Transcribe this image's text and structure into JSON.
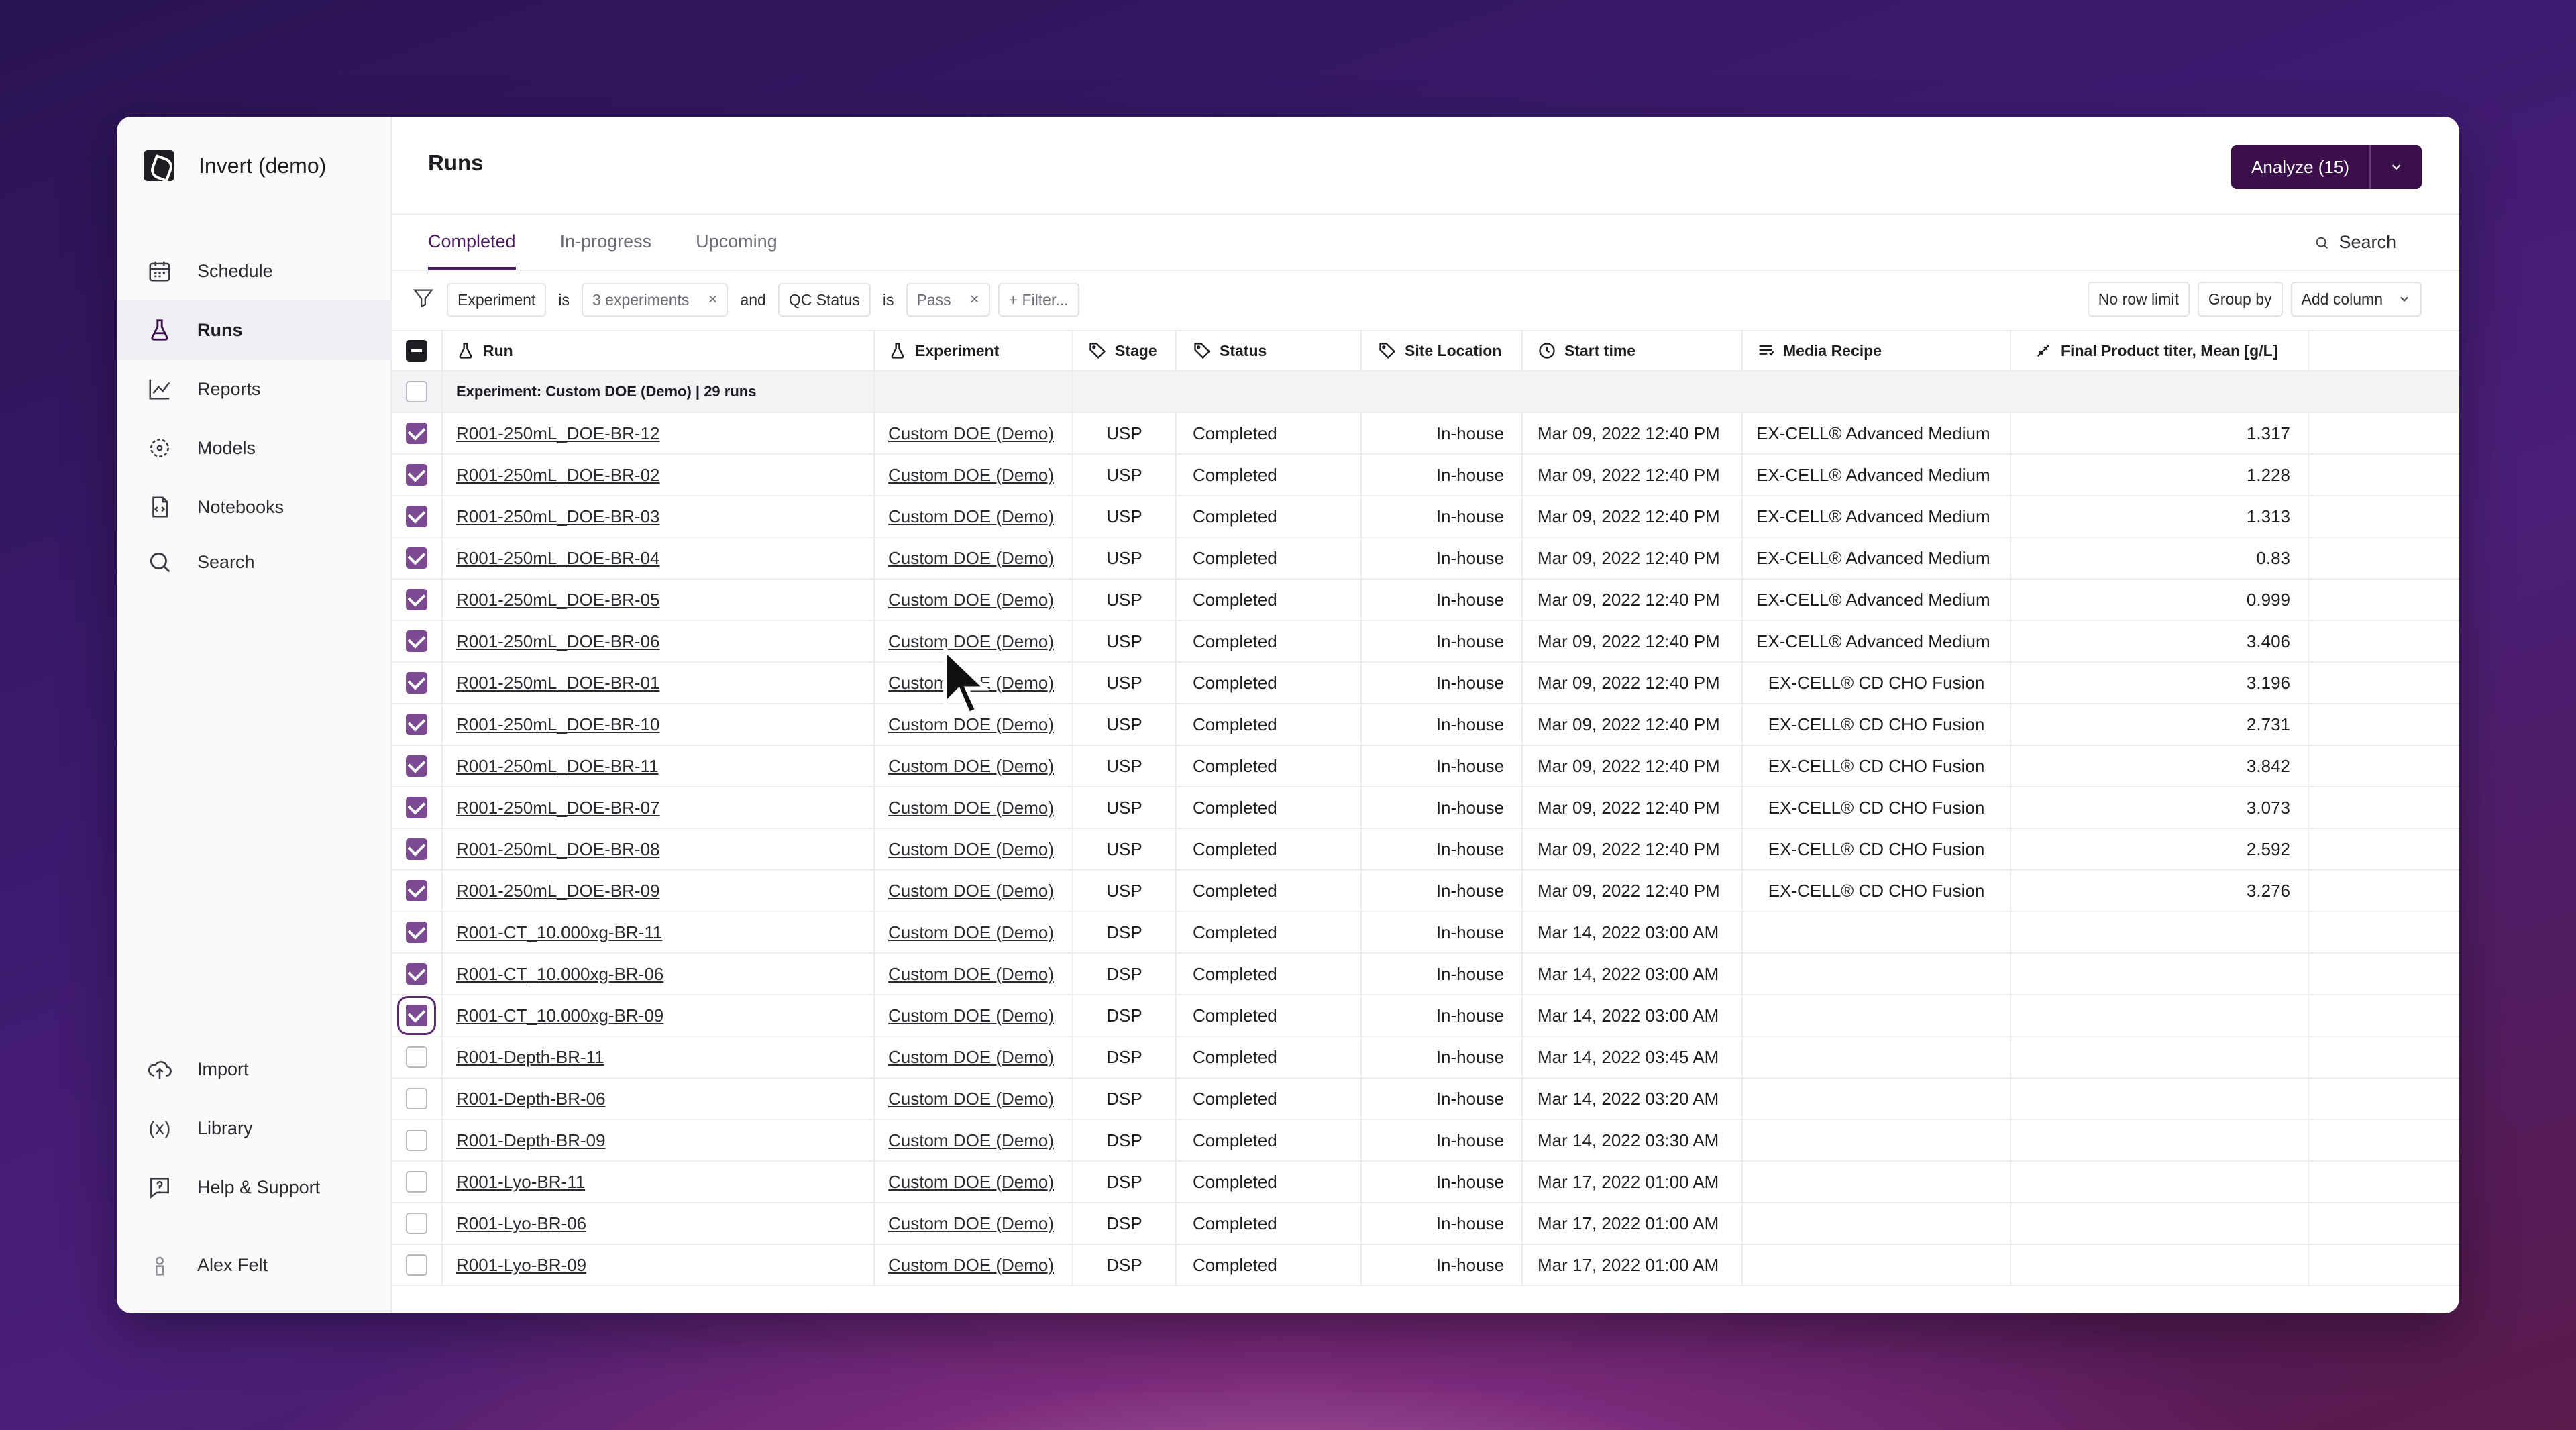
{
  "app": {
    "name": "Invert (demo)"
  },
  "sidebar": {
    "items": [
      {
        "label": "Schedule",
        "icon": "calendar-icon"
      },
      {
        "label": "Runs",
        "icon": "flask-icon",
        "active": true
      },
      {
        "label": "Reports",
        "icon": "chart-line-icon"
      },
      {
        "label": "Models",
        "icon": "models-icon"
      },
      {
        "label": "Notebooks",
        "icon": "notebook-icon"
      },
      {
        "label": "Search",
        "icon": "search-icon"
      }
    ],
    "bottom_items": [
      {
        "label": "Import",
        "icon": "upload-cloud-icon"
      },
      {
        "label": "Library",
        "icon": "function-icon"
      },
      {
        "label": "Help & Support",
        "icon": "help-icon"
      }
    ],
    "user": {
      "name": "Alex Felt",
      "icon": "user-icon"
    }
  },
  "header": {
    "title": "Runs",
    "analyze_label": "Analyze (15)"
  },
  "tabs": [
    "Completed",
    "In-progress",
    "Upcoming"
  ],
  "search_label": "Search",
  "filters": {
    "f1_field": "Experiment",
    "f1_op": "is",
    "f1_value": "3 experiments",
    "joiner": "and",
    "f2_field": "QC Status",
    "f2_op": "is",
    "f2_value": "Pass",
    "add_filter": "+ Filter..."
  },
  "toolbar": {
    "row_limit": "No row limit",
    "group_by": "Group by",
    "add_column": "Add column"
  },
  "table": {
    "headers": {
      "run": "Run",
      "experiment": "Experiment",
      "stage": "Stage",
      "status": "Status",
      "site": "Site Location",
      "start": "Start time",
      "media": "Media Recipe",
      "titer": "Final Product titer, Mean [g/L]"
    },
    "group_label": "Experiment: Custom DOE (Demo) | 29 runs",
    "rows": [
      {
        "checked": true,
        "run": "R001-250mL_DOE-BR-12",
        "experiment": "Custom DOE (Demo)",
        "stage": "USP",
        "status": "Completed",
        "site": "In-house",
        "start": "Mar 09, 2022 12:40 PM",
        "media": "EX-CELL® Advanced Medium",
        "titer": "1.317"
      },
      {
        "checked": true,
        "run": "R001-250mL_DOE-BR-02",
        "experiment": "Custom DOE (Demo)",
        "stage": "USP",
        "status": "Completed",
        "site": "In-house",
        "start": "Mar 09, 2022 12:40 PM",
        "media": "EX-CELL® Advanced Medium",
        "titer": "1.228"
      },
      {
        "checked": true,
        "run": "R001-250mL_DOE-BR-03",
        "experiment": "Custom DOE (Demo)",
        "stage": "USP",
        "status": "Completed",
        "site": "In-house",
        "start": "Mar 09, 2022 12:40 PM",
        "media": "EX-CELL® Advanced Medium",
        "titer": "1.313"
      },
      {
        "checked": true,
        "run": "R001-250mL_DOE-BR-04",
        "experiment": "Custom DOE (Demo)",
        "stage": "USP",
        "status": "Completed",
        "site": "In-house",
        "start": "Mar 09, 2022 12:40 PM",
        "media": "EX-CELL® Advanced Medium",
        "titer": "0.83"
      },
      {
        "checked": true,
        "run": "R001-250mL_DOE-BR-05",
        "experiment": "Custom DOE (Demo)",
        "stage": "USP",
        "status": "Completed",
        "site": "In-house",
        "start": "Mar 09, 2022 12:40 PM",
        "media": "EX-CELL® Advanced Medium",
        "titer": "0.999"
      },
      {
        "checked": true,
        "run": "R001-250mL_DOE-BR-06",
        "experiment": "Custom DOE (Demo)",
        "stage": "USP",
        "status": "Completed",
        "site": "In-house",
        "start": "Mar 09, 2022 12:40 PM",
        "media": "EX-CELL® Advanced Medium",
        "titer": "3.406"
      },
      {
        "checked": true,
        "run": "R001-250mL_DOE-BR-01",
        "experiment": "Custom DOE (Demo)",
        "stage": "USP",
        "status": "Completed",
        "site": "In-house",
        "start": "Mar 09, 2022 12:40 PM",
        "media": "EX-CELL® CD CHO Fusion",
        "titer": "3.196"
      },
      {
        "checked": true,
        "run": "R001-250mL_DOE-BR-10",
        "experiment": "Custom DOE (Demo)",
        "stage": "USP",
        "status": "Completed",
        "site": "In-house",
        "start": "Mar 09, 2022 12:40 PM",
        "media": "EX-CELL® CD CHO Fusion",
        "titer": "2.731"
      },
      {
        "checked": true,
        "run": "R001-250mL_DOE-BR-11",
        "experiment": "Custom DOE (Demo)",
        "stage": "USP",
        "status": "Completed",
        "site": "In-house",
        "start": "Mar 09, 2022 12:40 PM",
        "media": "EX-CELL® CD CHO Fusion",
        "titer": "3.842"
      },
      {
        "checked": true,
        "run": "R001-250mL_DOE-BR-07",
        "experiment": "Custom DOE (Demo)",
        "stage": "USP",
        "status": "Completed",
        "site": "In-house",
        "start": "Mar 09, 2022 12:40 PM",
        "media": "EX-CELL® CD CHO Fusion",
        "titer": "3.073"
      },
      {
        "checked": true,
        "run": "R001-250mL_DOE-BR-08",
        "experiment": "Custom DOE (Demo)",
        "stage": "USP",
        "status": "Completed",
        "site": "In-house",
        "start": "Mar 09, 2022 12:40 PM",
        "media": "EX-CELL® CD CHO Fusion",
        "titer": "2.592"
      },
      {
        "checked": true,
        "run": "R001-250mL_DOE-BR-09",
        "experiment": "Custom DOE (Demo)",
        "stage": "USP",
        "status": "Completed",
        "site": "In-house",
        "start": "Mar 09, 2022 12:40 PM",
        "media": "EX-CELL® CD CHO Fusion",
        "titer": "3.276"
      },
      {
        "checked": true,
        "run": "R001-CT_10.000xg-BR-11",
        "experiment": "Custom DOE (Demo)",
        "stage": "DSP",
        "status": "Completed",
        "site": "In-house",
        "start": "Mar 14, 2022 03:00 AM",
        "media": "",
        "titer": ""
      },
      {
        "checked": true,
        "run": "R001-CT_10.000xg-BR-06",
        "experiment": "Custom DOE (Demo)",
        "stage": "DSP",
        "status": "Completed",
        "site": "In-house",
        "start": "Mar 14, 2022 03:00 AM",
        "media": "",
        "titer": ""
      },
      {
        "checked": true,
        "focused": true,
        "run": "R001-CT_10.000xg-BR-09",
        "experiment": "Custom DOE (Demo)",
        "stage": "DSP",
        "status": "Completed",
        "site": "In-house",
        "start": "Mar 14, 2022 03:00 AM",
        "media": "",
        "titer": ""
      },
      {
        "checked": false,
        "run": "R001-Depth-BR-11",
        "experiment": "Custom DOE (Demo)",
        "stage": "DSP",
        "status": "Completed",
        "site": "In-house",
        "start": "Mar 14, 2022 03:45 AM",
        "media": "",
        "titer": ""
      },
      {
        "checked": false,
        "run": "R001-Depth-BR-06",
        "experiment": "Custom DOE (Demo)",
        "stage": "DSP",
        "status": "Completed",
        "site": "In-house",
        "start": "Mar 14, 2022 03:20 AM",
        "media": "",
        "titer": ""
      },
      {
        "checked": false,
        "run": "R001-Depth-BR-09",
        "experiment": "Custom DOE (Demo)",
        "stage": "DSP",
        "status": "Completed",
        "site": "In-house",
        "start": "Mar 14, 2022 03:30 AM",
        "media": "",
        "titer": ""
      },
      {
        "checked": false,
        "run": "R001-Lyo-BR-11",
        "experiment": "Custom DOE (Demo)",
        "stage": "DSP",
        "status": "Completed",
        "site": "In-house",
        "start": "Mar 17, 2022 01:00 AM",
        "media": "",
        "titer": ""
      },
      {
        "checked": false,
        "run": "R001-Lyo-BR-06",
        "experiment": "Custom DOE (Demo)",
        "stage": "DSP",
        "status": "Completed",
        "site": "In-house",
        "start": "Mar 17, 2022 01:00 AM",
        "media": "",
        "titer": ""
      },
      {
        "checked": false,
        "run": "R001-Lyo-BR-09",
        "experiment": "Custom DOE (Demo)",
        "stage": "DSP",
        "status": "Completed",
        "site": "In-house",
        "start": "Mar 17, 2022 01:00 AM",
        "media": "",
        "titer": ""
      }
    ]
  },
  "colors": {
    "accent": "#3b0f4a",
    "checkbox": "#7b4a93"
  }
}
